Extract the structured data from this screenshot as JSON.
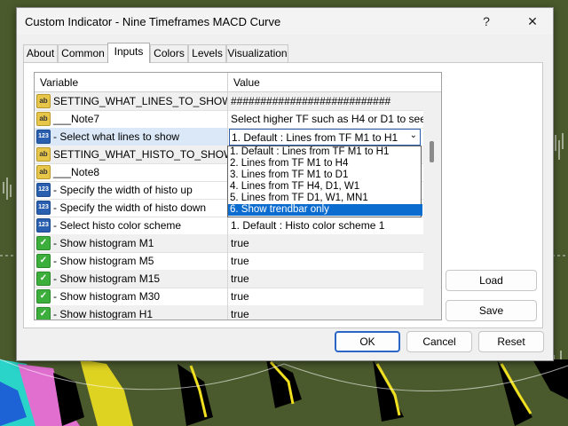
{
  "window": {
    "title": "Custom Indicator - Nine Timeframes MACD Curve",
    "help_label": "?",
    "close_label": "✕"
  },
  "tabs": [
    {
      "label": "About"
    },
    {
      "label": "Common"
    },
    {
      "label": "Inputs",
      "active": true
    },
    {
      "label": "Colors"
    },
    {
      "label": "Levels"
    },
    {
      "label": "Visualization"
    }
  ],
  "grid": {
    "header": {
      "variable": "Variable",
      "value": "Value"
    },
    "rows": [
      {
        "icon": "ab",
        "variable": "SETTING_WHAT_LINES_TO_SHOW",
        "value": "###########################"
      },
      {
        "icon": "ab",
        "variable": "___Note7",
        "value": "Select higher TF such as H4 or D1 to see t..."
      },
      {
        "icon": "123",
        "variable": "- Select what lines to show",
        "value": "1. Default : Lines from TF M1 to H1"
      },
      {
        "icon": "ab",
        "variable": "SETTING_WHAT_HISTO_TO_SHOW",
        "value": ""
      },
      {
        "icon": "ab",
        "variable": "___Note8",
        "value": ""
      },
      {
        "icon": "123",
        "variable": "- Specify the width of histo up",
        "value": ""
      },
      {
        "icon": "123",
        "variable": "- Specify the width of histo down",
        "value": ""
      },
      {
        "icon": "123",
        "variable": "- Select histo color scheme",
        "value": "1. Default : Histo color scheme 1"
      },
      {
        "icon": "bool",
        "variable": "- Show histogram M1",
        "value": "true"
      },
      {
        "icon": "bool",
        "variable": "- Show histogram M5",
        "value": "true"
      },
      {
        "icon": "bool",
        "variable": "- Show histogram M15",
        "value": "true"
      },
      {
        "icon": "bool",
        "variable": "- Show histogram M30",
        "value": "true"
      },
      {
        "icon": "bool",
        "variable": "- Show histogram H1",
        "value": "true"
      }
    ]
  },
  "dropdown": {
    "options": [
      "1. Default : Lines from TF M1 to H1",
      "2. Lines from TF M1 to H4",
      "3. Lines from TF M1 to D1",
      "4. Lines from TF H4, D1, W1",
      "5. Lines from TF D1, W1, MN1",
      "6. Show trendbar only"
    ],
    "highlighted_index": 5,
    "arrow_label": "⌄"
  },
  "icons": {
    "ab": "ab",
    "123": "123",
    "bool": "✓"
  },
  "side_buttons": {
    "load": "Load",
    "save": "Save"
  },
  "footer_buttons": {
    "ok": "OK",
    "cancel": "Cancel",
    "reset": "Reset"
  },
  "colors": {
    "accent": "#0a6ccf",
    "chart_bg": "#4b5a2c"
  }
}
